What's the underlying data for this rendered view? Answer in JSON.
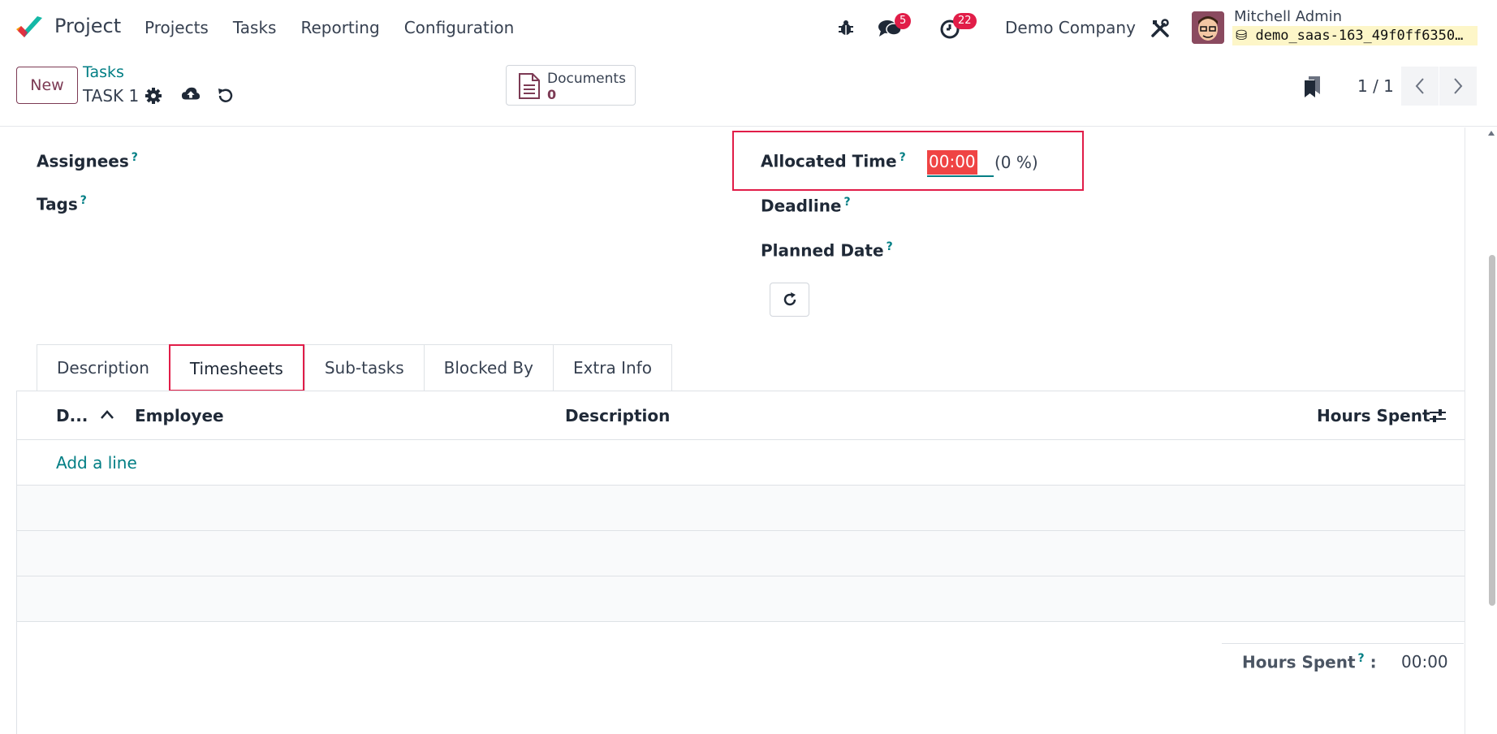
{
  "topnav": {
    "app_name": "Project",
    "menu": [
      "Projects",
      "Tasks",
      "Reporting",
      "Configuration"
    ],
    "messages_badge": "5",
    "activities_badge": "22",
    "company": "Demo Company",
    "user_name": "Mitchell Admin",
    "db_name": "demo_saas-163_49f0ff6350…"
  },
  "control_panel": {
    "new_label": "New",
    "breadcrumb_parent": "Tasks",
    "breadcrumb_current": "TASK 1",
    "documents_label": "Documents",
    "documents_count": "0",
    "pager": "1 / 1"
  },
  "form": {
    "assignees_label": "Assignees",
    "tags_label": "Tags",
    "allocated_time_label": "Allocated Time",
    "allocated_time_value": "00:00",
    "allocated_time_pct": "(0 %)",
    "deadline_label": "Deadline",
    "planned_date_label": "Planned Date",
    "help_mark": "?"
  },
  "tabs": [
    "Description",
    "Timesheets",
    "Sub-tasks",
    "Blocked By",
    "Extra Info"
  ],
  "active_tab": "Timesheets",
  "timesheet_table": {
    "columns": [
      "D...",
      "Employee",
      "Description",
      "Hours Spent"
    ],
    "add_line": "Add a line",
    "total_label": "Hours Spent",
    "total_suffix": ":",
    "total_value": "00:00"
  },
  "colors": {
    "brand": "#7c3a54",
    "link": "#017e84",
    "highlight": "#e11d48"
  }
}
